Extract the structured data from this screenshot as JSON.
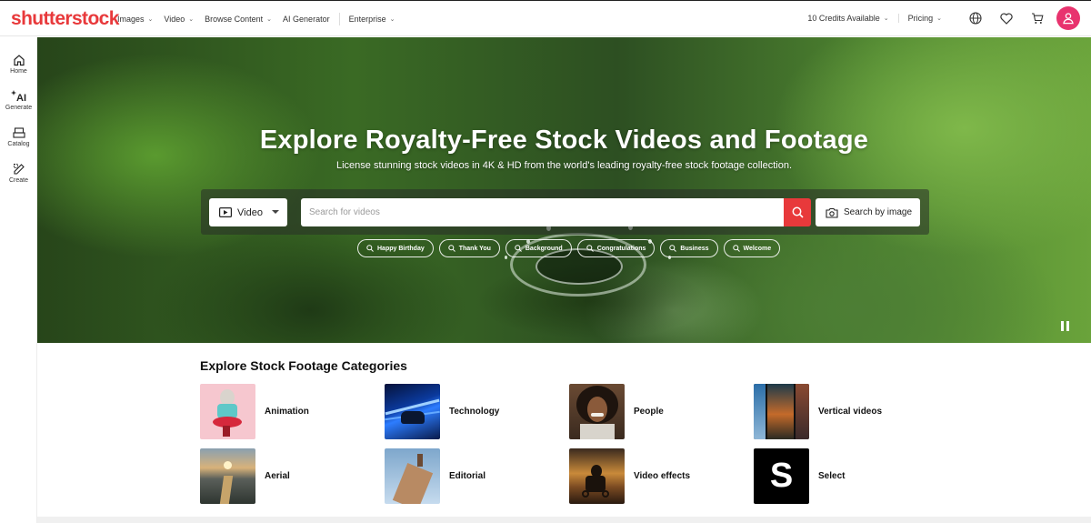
{
  "brand": {
    "logo_text": "shutterstock",
    "accent": "#e8393b"
  },
  "nav": {
    "items": [
      {
        "label": "Images",
        "has_menu": true
      },
      {
        "label": "Video",
        "has_menu": true
      },
      {
        "label": "Browse Content",
        "has_menu": true
      },
      {
        "label": "AI Generator",
        "has_menu": false
      },
      {
        "label": "Enterprise",
        "has_menu": true
      }
    ],
    "credits": "10 Credits Available",
    "pricing": "Pricing",
    "icons": [
      "globe-icon",
      "heart-icon",
      "cart-icon",
      "user-avatar-icon"
    ]
  },
  "rail": {
    "items": [
      {
        "label": "Home",
        "icon": "home-icon"
      },
      {
        "label": "Generate",
        "icon": "ai-generate-icon"
      },
      {
        "label": "Catalog",
        "icon": "catalog-icon"
      },
      {
        "label": "Create",
        "icon": "create-icon"
      }
    ]
  },
  "hero": {
    "title": "Explore Royalty-Free Stock Videos and Footage",
    "subtitle": "License stunning stock videos in 4K & HD from the world's leading royalty-free stock footage collection.",
    "media_type": "Video",
    "search_placeholder": "Search for videos",
    "search_by_image": "Search by image",
    "chips": [
      "Happy Birthday",
      "Thank You",
      "Background",
      "Congratulations",
      "Business",
      "Welcome"
    ]
  },
  "categories": {
    "title": "Explore Stock Footage Categories",
    "items": [
      {
        "label": "Animation",
        "thumb": "animation"
      },
      {
        "label": "Technology",
        "thumb": "technology"
      },
      {
        "label": "People",
        "thumb": "people"
      },
      {
        "label": "Vertical videos",
        "thumb": "vertical"
      },
      {
        "label": "Aerial",
        "thumb": "aerial"
      },
      {
        "label": "Editorial",
        "thumb": "editorial"
      },
      {
        "label": "Video effects",
        "thumb": "effects"
      },
      {
        "label": "Select",
        "thumb": "select"
      }
    ]
  }
}
